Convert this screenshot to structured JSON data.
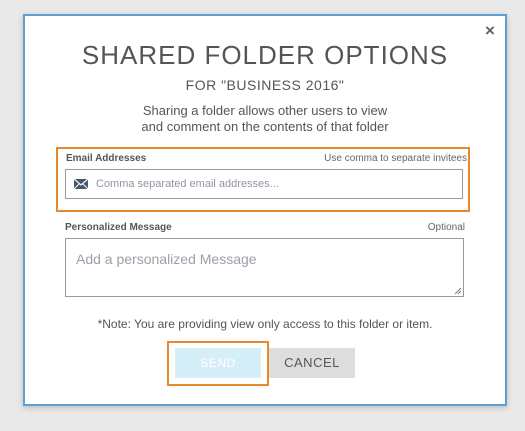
{
  "dialog": {
    "close_symbol": "×",
    "title": "SHARED FOLDER OPTIONS",
    "subtitle": "FOR \"BUSINESS 2016\"",
    "description_line1": "Sharing a folder allows other users to view",
    "description_line2": "and comment on the contents of that folder"
  },
  "email": {
    "label": "Email Addresses",
    "hint": "Use comma to separate invitees",
    "placeholder": "Comma separated email addresses...",
    "value": "",
    "icon": "mail-icon"
  },
  "message": {
    "label": "Personalized Message",
    "hint": "Optional",
    "placeholder": "Add a personalized Message",
    "value": ""
  },
  "note": "*Note: You are providing view only access to this folder or item.",
  "buttons": {
    "send_label": "SEND",
    "cancel_label": "CANCEL"
  },
  "colors": {
    "dialog_border": "#5b9fd3",
    "highlight": "#e8892e",
    "send_bg": "#d6eef8",
    "cancel_bg": "#dddddd"
  }
}
